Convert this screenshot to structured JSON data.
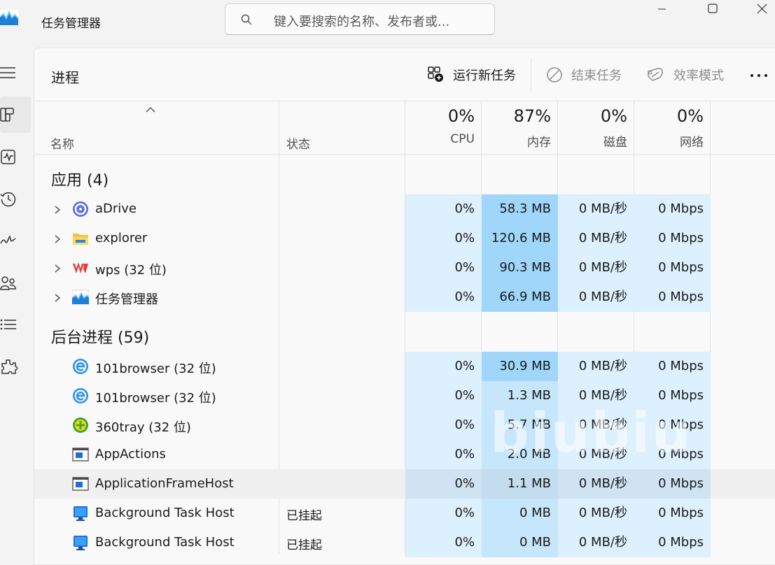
{
  "app": {
    "title": "任务管理器",
    "search_placeholder": "键入要搜索的名称、发布者或..."
  },
  "nav": {
    "items": [
      {
        "icon": "hamburger-menu-icon"
      },
      {
        "icon": "processes-icon",
        "selected": true
      },
      {
        "icon": "performance-icon"
      },
      {
        "icon": "app-history-icon"
      },
      {
        "icon": "startup-apps-icon"
      },
      {
        "icon": "users-icon"
      },
      {
        "icon": "details-icon"
      },
      {
        "icon": "services-icon"
      }
    ]
  },
  "page": {
    "title": "进程",
    "commands": {
      "run_new_task": "运行新任务",
      "end_task": "结束任务",
      "efficiency_mode": "效率模式"
    }
  },
  "table": {
    "headers": {
      "name": "名称",
      "status": "状态",
      "cpu_pct": "0%",
      "cpu": "CPU",
      "mem_pct": "87%",
      "mem": "内存",
      "disk_pct": "0%",
      "disk": "磁盘",
      "net_pct": "0%",
      "net": "网络"
    },
    "groups": [
      {
        "label": "应用 (4)"
      },
      {
        "label": "后台进程 (59)"
      }
    ],
    "apps": [
      {
        "name": "aDrive",
        "icon": "adrive-icon",
        "status": "",
        "cpu": "0%",
        "mem": "58.3 MB",
        "disk": "0 MB/秒",
        "net": "0 Mbps"
      },
      {
        "name": "explorer",
        "icon": "folder-icon",
        "status": "",
        "cpu": "0%",
        "mem": "120.6 MB",
        "disk": "0 MB/秒",
        "net": "0 Mbps"
      },
      {
        "name": "wps (32 位)",
        "icon": "wps-icon",
        "status": "",
        "cpu": "0%",
        "mem": "90.3 MB",
        "disk": "0 MB/秒",
        "net": "0 Mbps"
      },
      {
        "name": "任务管理器",
        "icon": "task-manager-icon",
        "status": "",
        "cpu": "0%",
        "mem": "66.9 MB",
        "disk": "0 MB/秒",
        "net": "0 Mbps"
      }
    ],
    "background": [
      {
        "name": "101browser (32 位)",
        "icon": "browser-e-icon",
        "status": "",
        "cpu": "0%",
        "mem": "30.9 MB",
        "disk": "0 MB/秒",
        "net": "0 Mbps"
      },
      {
        "name": "101browser (32 位)",
        "icon": "browser-e-icon",
        "status": "",
        "cpu": "0%",
        "mem": "1.3 MB",
        "disk": "0 MB/秒",
        "net": "0 Mbps"
      },
      {
        "name": "360tray (32 位)",
        "icon": "360-icon",
        "status": "",
        "cpu": "0%",
        "mem": "5.7 MB",
        "disk": "0 MB/秒",
        "net": "0 Mbps"
      },
      {
        "name": "AppActions",
        "icon": "app-window-icon",
        "status": "",
        "cpu": "0%",
        "mem": "2.0 MB",
        "disk": "0 MB/秒",
        "net": "0 Mbps"
      },
      {
        "name": "ApplicationFrameHost",
        "icon": "app-window-icon",
        "status": "",
        "cpu": "0%",
        "mem": "1.1 MB",
        "disk": "0 MB/秒",
        "net": "0 Mbps"
      },
      {
        "name": "Background Task Host",
        "icon": "monitor-icon",
        "status": "已挂起",
        "cpu": "0%",
        "mem": "0 MB",
        "disk": "0 MB/秒",
        "net": "0 Mbps"
      },
      {
        "name": "Background Task Host",
        "icon": "monitor-icon",
        "status": "已挂起",
        "cpu": "0%",
        "mem": "0 MB",
        "disk": "0 MB/秒",
        "net": "0 Mbps"
      }
    ]
  },
  "watermark": "biubiu",
  "colors": {
    "heat_light": "#dcf0fd",
    "heat_mid": "#c6e6fb",
    "heat_strong": "#9fd6fa",
    "accent": "#0067c0"
  }
}
